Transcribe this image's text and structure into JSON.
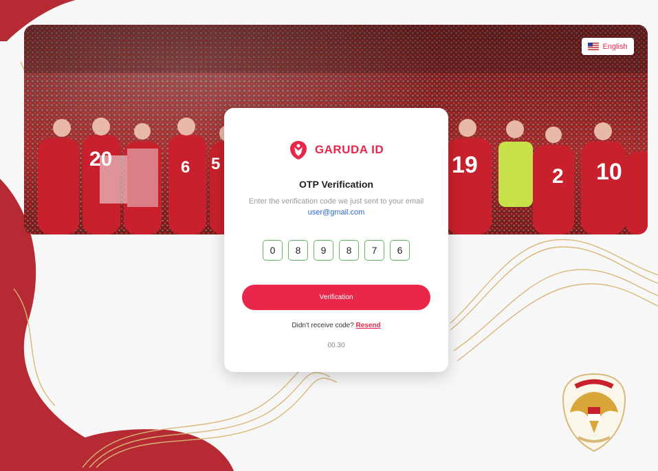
{
  "language": {
    "label": "English",
    "flag_icon": "us-flag-icon"
  },
  "brand": {
    "name": "GARUDA ID",
    "logo_icon": "garuda-logo-icon",
    "color": "#e8274b"
  },
  "otp": {
    "title": "OTP Verification",
    "subtitle_prefix": "Enter  the verification code we just sent to your email",
    "email": "user@gmail.com",
    "digits": [
      "0",
      "8",
      "9",
      "8",
      "7",
      "6"
    ],
    "verify_label": "Verification",
    "resend_prompt": "Didn't receive code?",
    "resend_label": "Resend",
    "timer": "00.30"
  },
  "colors": {
    "accent": "#e8274b",
    "otp_border": "#5fb85f",
    "link": "#2b66d8",
    "bg_red": "#b52a33",
    "gold": "#d8b878"
  }
}
